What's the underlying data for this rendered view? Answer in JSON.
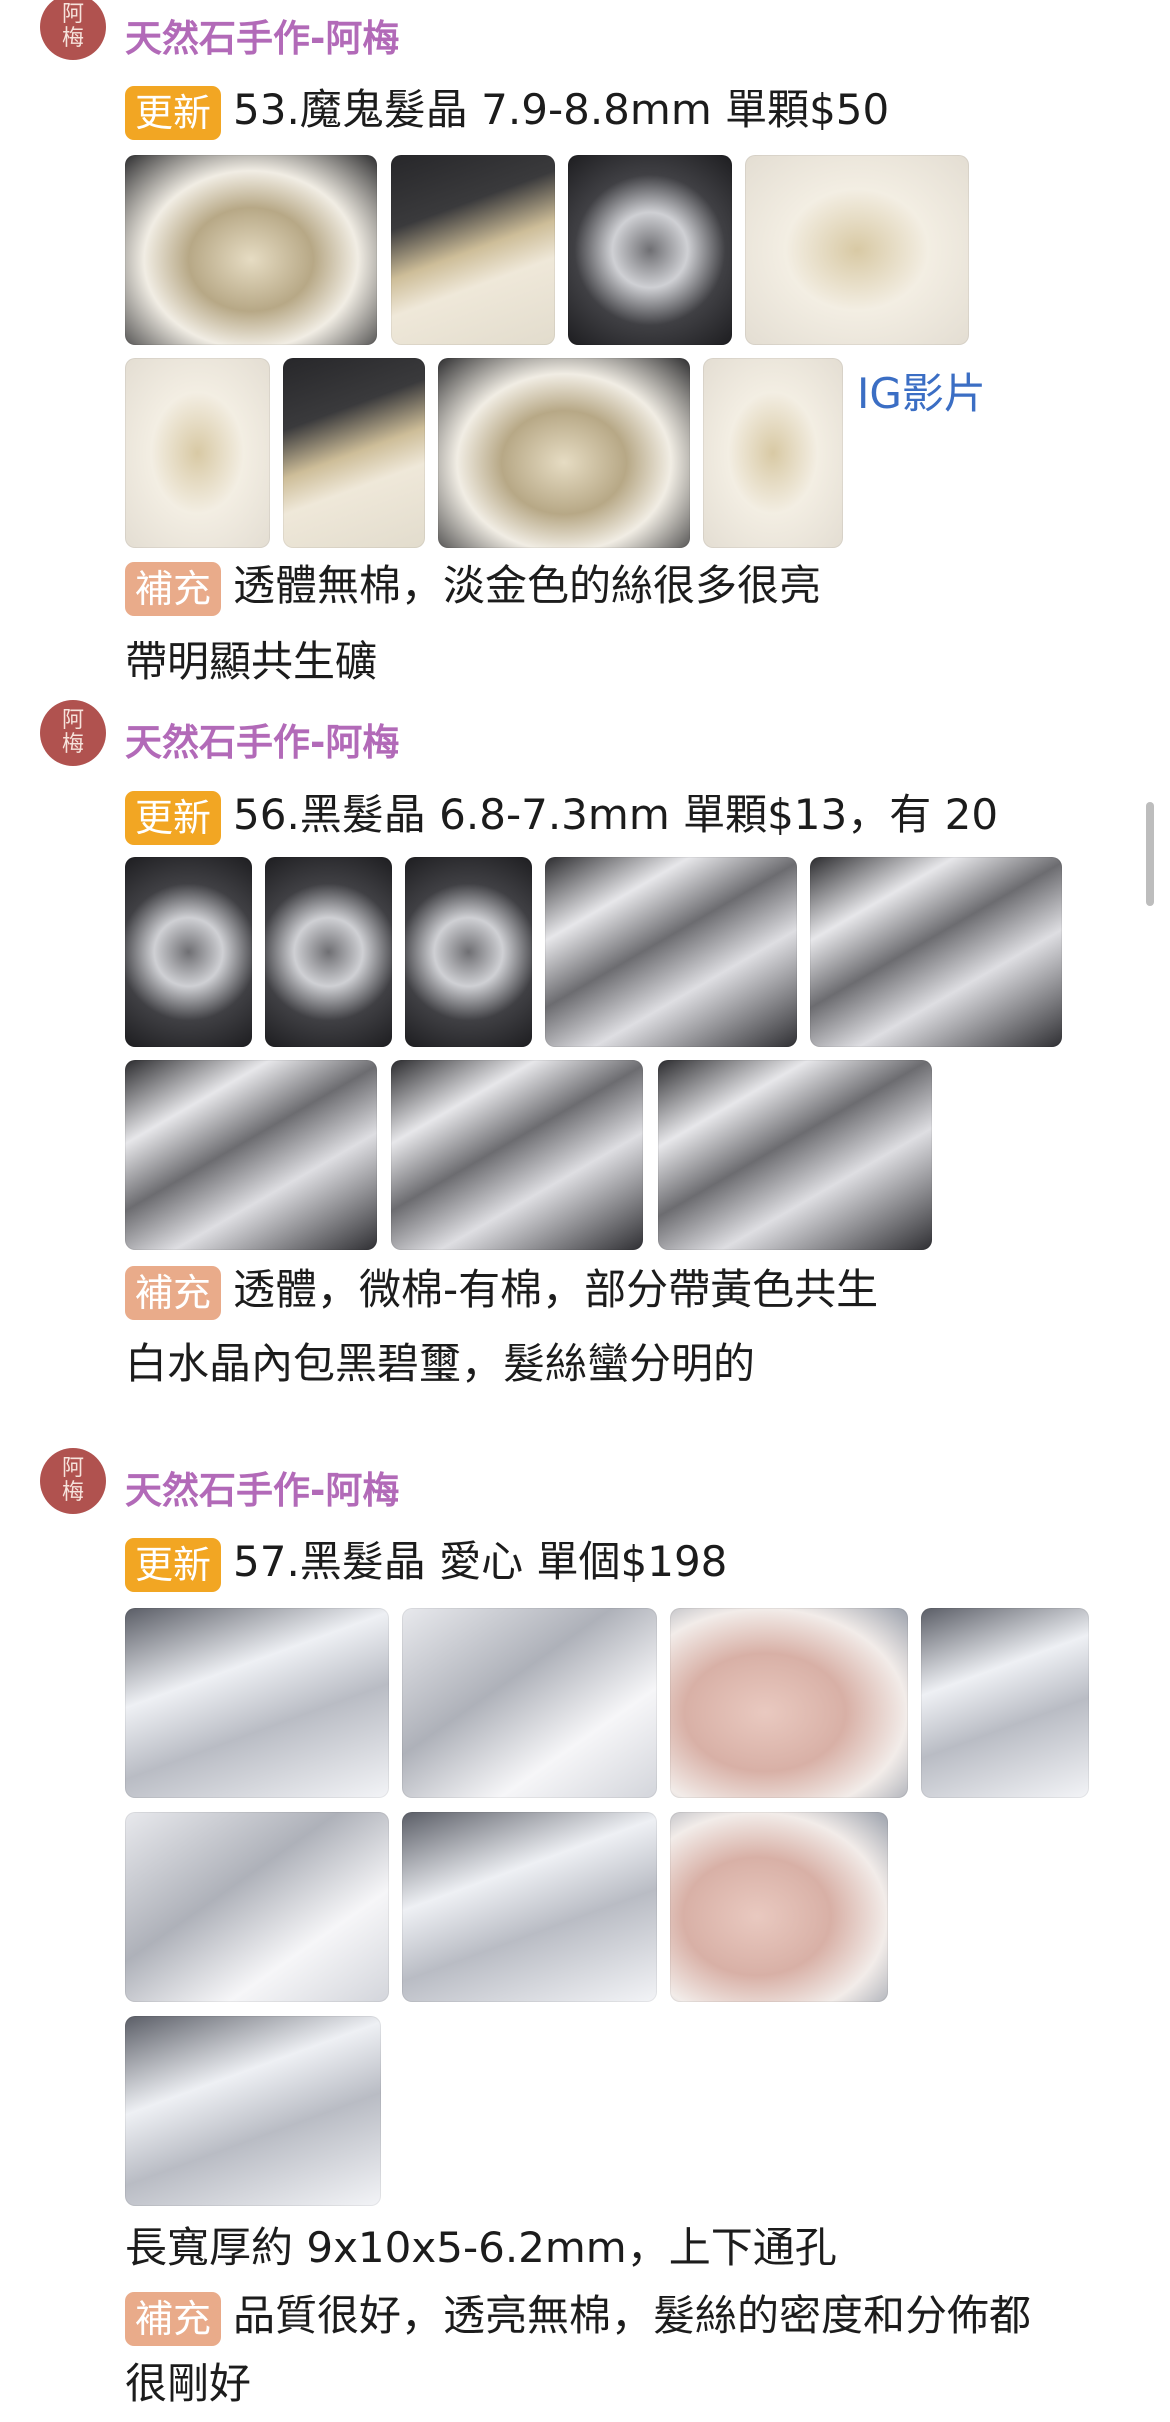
{
  "avatar_text": [
    "阿",
    "梅"
  ],
  "posts": [
    {
      "author": "天然石手作-阿梅",
      "update_tag": "更新",
      "title": "53.魔鬼髮晶 7.9-8.8mm 單顆$50",
      "link": "IG影片",
      "extra_tag": "補充",
      "extra_text": "透體無棉，淡金色的絲很多很亮",
      "extra_text2": "帶明顯共生礦"
    },
    {
      "author": "天然石手作-阿梅",
      "update_tag": "更新",
      "title": "56.黑髮晶 6.8-7.3mm 單顆$13，有 20",
      "extra_tag": "補充",
      "extra_text": "透體，微棉-有棉，部分帶黃色共生",
      "extra_text2": "白水晶內包黑碧璽，髮絲蠻分明的"
    },
    {
      "author": "天然石手作-阿梅",
      "update_tag": "更新",
      "title": "57.黑髮晶 愛心 單個$198",
      "size_text": "長寬厚約 9x10x5-6.2mm，上下通孔",
      "extra_tag": "補充",
      "extra_text": "品質很好，透亮無棉，髮絲的密度和分佈都",
      "extra_text2": "很剛好"
    }
  ],
  "colors": {
    "author": "#b26ab8",
    "update_tag": "#f2a623",
    "extra_tag": "#e9ab8a",
    "link": "#3b6ec4",
    "avatar": "#b0524f"
  }
}
